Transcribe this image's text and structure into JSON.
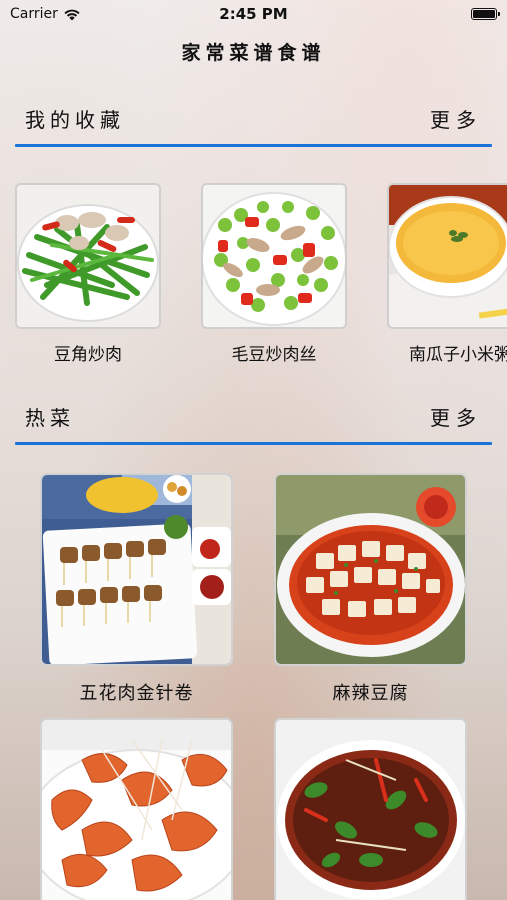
{
  "status_bar": {
    "carrier": "Carrier",
    "time": "2:45 PM"
  },
  "nav": {
    "title": "家常菜谱食谱"
  },
  "favorites": {
    "title": "我的收藏",
    "more": "更多",
    "items": [
      {
        "name": "豆角炒肉"
      },
      {
        "name": "毛豆炒肉丝"
      },
      {
        "name": "南瓜子小米粥"
      }
    ]
  },
  "hot": {
    "title": "热菜",
    "more": "更多",
    "items": [
      {
        "name": "五花肉金针卷"
      },
      {
        "name": "麻辣豆腐"
      },
      {
        "name": ""
      },
      {
        "name": ""
      }
    ]
  },
  "colors": {
    "accent": "#1a73d9"
  },
  "icons": {
    "wifi": "wifi-icon",
    "battery": "battery-icon"
  }
}
